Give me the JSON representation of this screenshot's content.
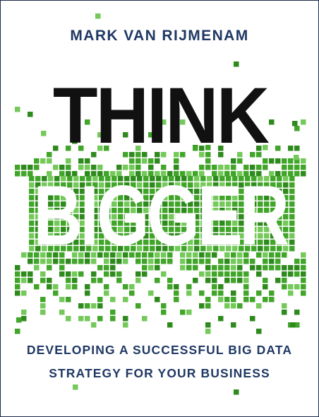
{
  "cover": {
    "author": "MARK VAN RIJMENAM",
    "title_line1": "THINK",
    "title_line2": "BIGGER",
    "subtitle_line1": "DEVELOPING A SUCCESSFUL BIG DATA",
    "subtitle_line2": "STRATEGY FOR YOUR BUSINESS"
  },
  "colors": {
    "navy": "#1f3864",
    "black": "#111111",
    "green_dark": "#2f8a1e",
    "green_mid": "#41a52a",
    "green_light": "#74c95a",
    "border": "#1b2a48"
  }
}
